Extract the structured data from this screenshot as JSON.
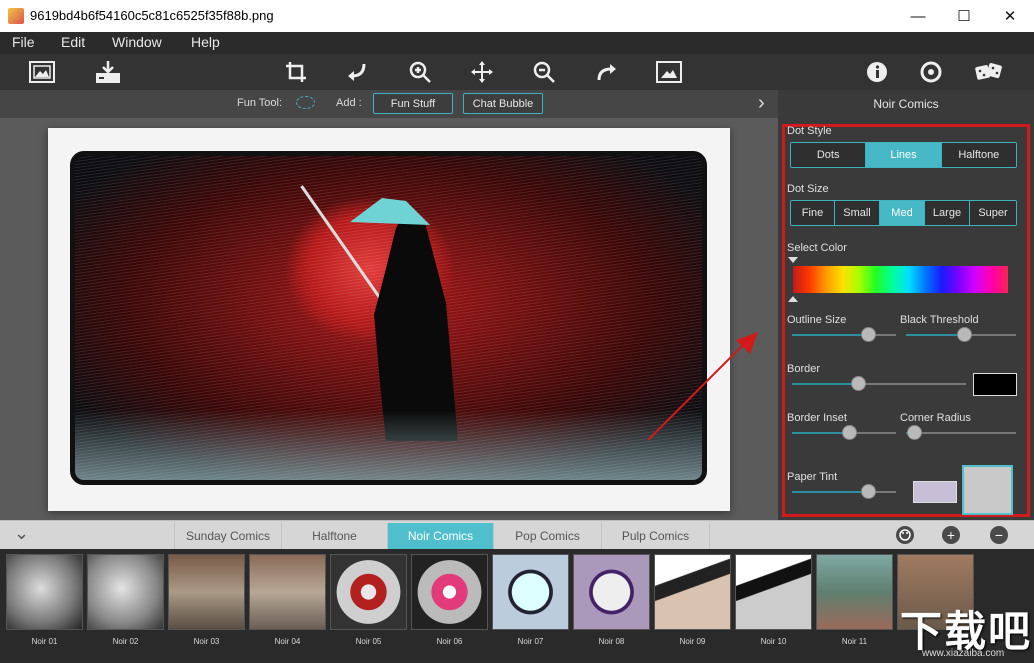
{
  "window": {
    "title": "9619bd4b6f54160c5c81c6525f35f88b.png",
    "minimize": "—",
    "maximize": "☐",
    "close": "✕"
  },
  "menu": [
    "File",
    "Edit",
    "Window",
    "Help"
  ],
  "subbar": {
    "fun_tool_label": "Fun Tool:",
    "add_label": "Add :",
    "fun_stuff": "Fun Stuff",
    "chat_bubble": "Chat Bubble",
    "expand_arrow": "›"
  },
  "panel": {
    "title": "Noir Comics",
    "dot_style": {
      "label": "Dot Style",
      "options": [
        "Dots",
        "Lines",
        "Halftone"
      ],
      "selected": "Lines"
    },
    "dot_size": {
      "label": "Dot Size",
      "options": [
        "Fine",
        "Small",
        "Med",
        "Large",
        "Super"
      ],
      "selected": "Med"
    },
    "select_color": {
      "label": "Select Color"
    },
    "outline_size": {
      "label": "Outline Size",
      "value": 0.73
    },
    "black_threshold": {
      "label": "Black Threshold",
      "value": 0.53
    },
    "border": {
      "label": "Border",
      "value": 0.38,
      "color": "#000000"
    },
    "border_inset": {
      "label": "Border Inset",
      "value": 0.55
    },
    "corner_radius": {
      "label": "Corner Radius",
      "value": 0.07
    },
    "paper_tint": {
      "label": "Paper Tint",
      "value": 0.73,
      "color": "#c6bfd6"
    }
  },
  "tabs": {
    "items": [
      "Sunday Comics",
      "Halftone",
      "Noir Comics",
      "Pop Comics",
      "Pulp Comics"
    ],
    "selected": "Noir Comics",
    "collapse": "⌄",
    "add": "+",
    "remove": "−"
  },
  "thumbnails": [
    "Noir 01",
    "Noir 02",
    "Noir 03",
    "Noir 04",
    "Noir 05",
    "Noir 06",
    "Noir 07",
    "Noir 08",
    "Noir 09",
    "Noir 10",
    "Noir 11",
    ""
  ],
  "watermark": {
    "big": "下载吧",
    "small": "www.xiazaiba.com"
  },
  "colors": {
    "accent": "#46b8c6",
    "highlight_frame": "#d11a1a"
  }
}
